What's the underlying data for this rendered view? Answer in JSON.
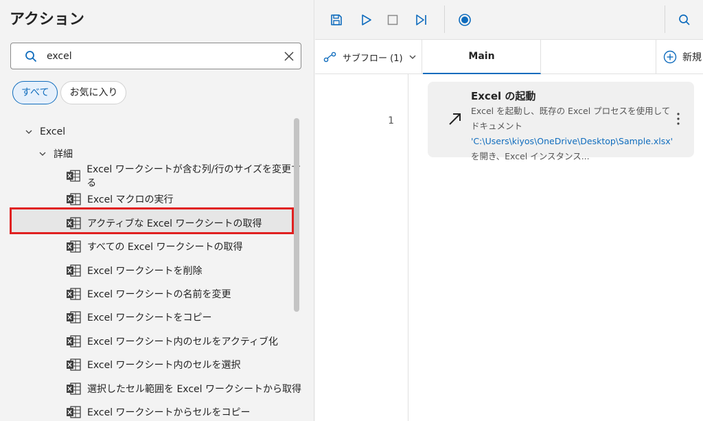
{
  "left_panel": {
    "title": "アクション",
    "search": {
      "value": "excel"
    },
    "filters": [
      {
        "label": "すべて",
        "active": true
      },
      {
        "label": "お気に入り",
        "active": false
      }
    ],
    "tree": {
      "group": "Excel",
      "subgroup": "詳細",
      "items": [
        "Excel ワークシートが含む列/行のサイズを変更する",
        "Excel マクロの実行",
        "アクティブな Excel ワークシートの取得",
        "すべての Excel ワークシートの取得",
        "Excel ワークシートを削除",
        "Excel ワークシートの名前を変更",
        "Excel ワークシートをコピー",
        "Excel ワークシート内のセルをアクティブ化",
        "Excel ワークシート内のセルを選択",
        "選択したセル範囲を Excel ワークシートから取得",
        "Excel ワークシートからセルをコピー"
      ],
      "highlighted_index": 7
    }
  },
  "right_panel": {
    "toolbar": {
      "icons": [
        "save-icon",
        "run-icon",
        "stop-icon",
        "step-icon",
        "record-icon",
        "search-icon"
      ]
    },
    "tabs": {
      "subflow_label": "サブフロー (1)",
      "main_label": "Main",
      "new_label": "新規"
    },
    "flow": {
      "line_number": "1",
      "step": {
        "title": "Excel の起動",
        "desc_prefix": "Excel を起動し、既存の Excel プロセスを使用してドキュメント ",
        "desc_link": "'C:\\Users\\kiyos\\OneDrive\\Desktop\\Sample.xlsx'",
        "desc_suffix": " を開き、Excel インスタンス..."
      }
    }
  },
  "colors": {
    "accent": "#0f6cbd",
    "highlight_border": "#e02020"
  }
}
